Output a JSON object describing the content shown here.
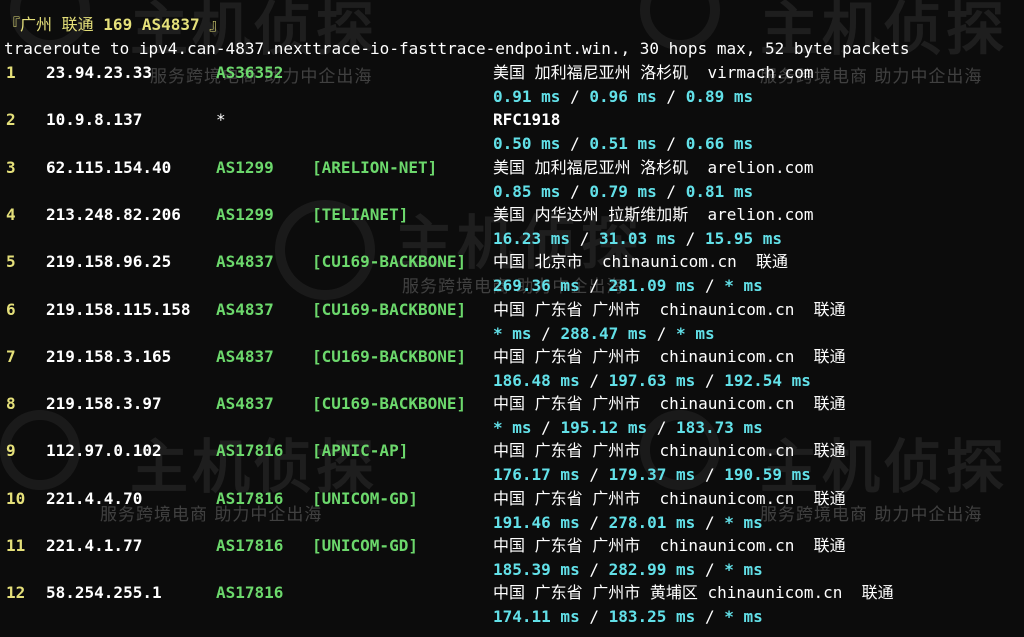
{
  "header": {
    "title_open": "『",
    "title_location": "广州 联通 ",
    "title_asn": "169 AS4837",
    "title_close": " 』",
    "command": "traceroute to ipv4.can-4837.nexttrace-io-fasttrace-endpoint.win., 30 hops max, 52 byte packets"
  },
  "watermark": {
    "brand": "主机侦探",
    "slogan": "服务跨境电商 助力中企出海"
  },
  "hops": [
    {
      "num": "1",
      "ip": "23.94.23.33",
      "asn": "AS36352",
      "tag": "",
      "geo": "美国 加利福尼亚州 洛杉矶  virmach.com",
      "r1": "0.91 ms",
      "r2": "0.96 ms",
      "r3": "0.89 ms"
    },
    {
      "num": "2",
      "ip": "10.9.8.137",
      "asn": "*",
      "tag": "",
      "geo": "RFC1918",
      "r1": "0.50 ms",
      "r2": "0.51 ms",
      "r3": "0.66 ms"
    },
    {
      "num": "3",
      "ip": "62.115.154.40",
      "asn": "AS1299",
      "tag": "[ARELION-NET]",
      "geo": "美国 加利福尼亚州 洛杉矶  arelion.com",
      "r1": "0.85 ms",
      "r2": "0.79 ms",
      "r3": "0.81 ms"
    },
    {
      "num": "4",
      "ip": "213.248.82.206",
      "asn": "AS1299",
      "tag": "[TELIANET]",
      "geo": "美国 内华达州 拉斯维加斯  arelion.com",
      "r1": "16.23 ms",
      "r2": "31.03 ms",
      "r3": "15.95 ms"
    },
    {
      "num": "5",
      "ip": "219.158.96.25",
      "asn": "AS4837",
      "tag": "[CU169-BACKBONE]",
      "geo": "中国 北京市  chinaunicom.cn  联通",
      "r1": "269.36 ms",
      "r2": "281.09 ms",
      "r3": "* ms"
    },
    {
      "num": "6",
      "ip": "219.158.115.158",
      "asn": "AS4837",
      "tag": "[CU169-BACKBONE]",
      "geo": "中国 广东省 广州市  chinaunicom.cn  联通",
      "r1": "* ms",
      "r2": "288.47 ms",
      "r3": "* ms"
    },
    {
      "num": "7",
      "ip": "219.158.3.165",
      "asn": "AS4837",
      "tag": "[CU169-BACKBONE]",
      "geo": "中国 广东省 广州市  chinaunicom.cn  联通",
      "r1": "186.48 ms",
      "r2": "197.63 ms",
      "r3": "192.54 ms"
    },
    {
      "num": "8",
      "ip": "219.158.3.97",
      "asn": "AS4837",
      "tag": "[CU169-BACKBONE]",
      "geo": "中国 广东省 广州市  chinaunicom.cn  联通",
      "r1": "* ms",
      "r2": "195.12 ms",
      "r3": "183.73 ms"
    },
    {
      "num": "9",
      "ip": "112.97.0.102",
      "asn": "AS17816",
      "tag": "[APNIC-AP]",
      "geo": "中国 广东省 广州市  chinaunicom.cn  联通",
      "r1": "176.17 ms",
      "r2": "179.37 ms",
      "r3": "190.59 ms"
    },
    {
      "num": "10",
      "ip": "221.4.4.70",
      "asn": "AS17816",
      "tag": "[UNICOM-GD]",
      "geo": "中国 广东省 广州市  chinaunicom.cn  联通",
      "r1": "191.46 ms",
      "r2": "278.01 ms",
      "r3": "* ms"
    },
    {
      "num": "11",
      "ip": "221.4.1.77",
      "asn": "AS17816",
      "tag": "[UNICOM-GD]",
      "geo": "中国 广东省 广州市  chinaunicom.cn  联通",
      "r1": "185.39 ms",
      "r2": "282.99 ms",
      "r3": "* ms"
    },
    {
      "num": "12",
      "ip": "58.254.255.1",
      "asn": "AS17816",
      "tag": "",
      "geo": "中国 广东省 广州市 黄埔区 chinaunicom.cn  联通",
      "r1": "174.11 ms",
      "r2": "183.25 ms",
      "r3": "* ms"
    }
  ],
  "rtt_separator": " / ",
  "colors": {
    "background": "#0c0c0c",
    "hop_number": "#e5e07a",
    "asn": "#6cd86c",
    "rtt": "#62e0e8",
    "text": "#ffffff"
  }
}
